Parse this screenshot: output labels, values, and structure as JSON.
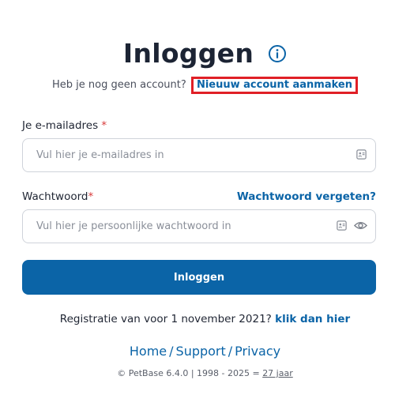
{
  "header": {
    "title": "Inloggen",
    "info_icon": "info-circle-icon",
    "signup_prefix": "Heb je nog geen account?",
    "signup_link": "Nieuuw account aanmaken"
  },
  "form": {
    "email": {
      "label": "Je e-mailadres",
      "required_mark": "*",
      "placeholder": "Vul hier je e-mailadres in",
      "value": "",
      "icon": "autofill-card-icon"
    },
    "password": {
      "label": "Wachtwoord",
      "required_mark": "*",
      "placeholder": "Vul hier je persoonlijke wachtwoord in",
      "value": "",
      "icons": [
        "autofill-card-icon",
        "eye-icon"
      ]
    },
    "forgot_link": "Wachtwoord vergeten?",
    "submit_label": "Inloggen"
  },
  "register": {
    "text": "Registratie van voor 1 november 2021?",
    "link": "klik dan hier"
  },
  "footer": {
    "links": [
      "Home",
      "Support",
      "Privacy"
    ],
    "separator": "/",
    "copyright_prefix": "© PetBase 6.4.0 | 1998 - 2025 =",
    "copyright_years": "27 jaar"
  },
  "colors": {
    "primary": "#0b64a7",
    "required": "#d83a3a",
    "highlight_border": "#e01f26",
    "title": "#1c2434"
  }
}
